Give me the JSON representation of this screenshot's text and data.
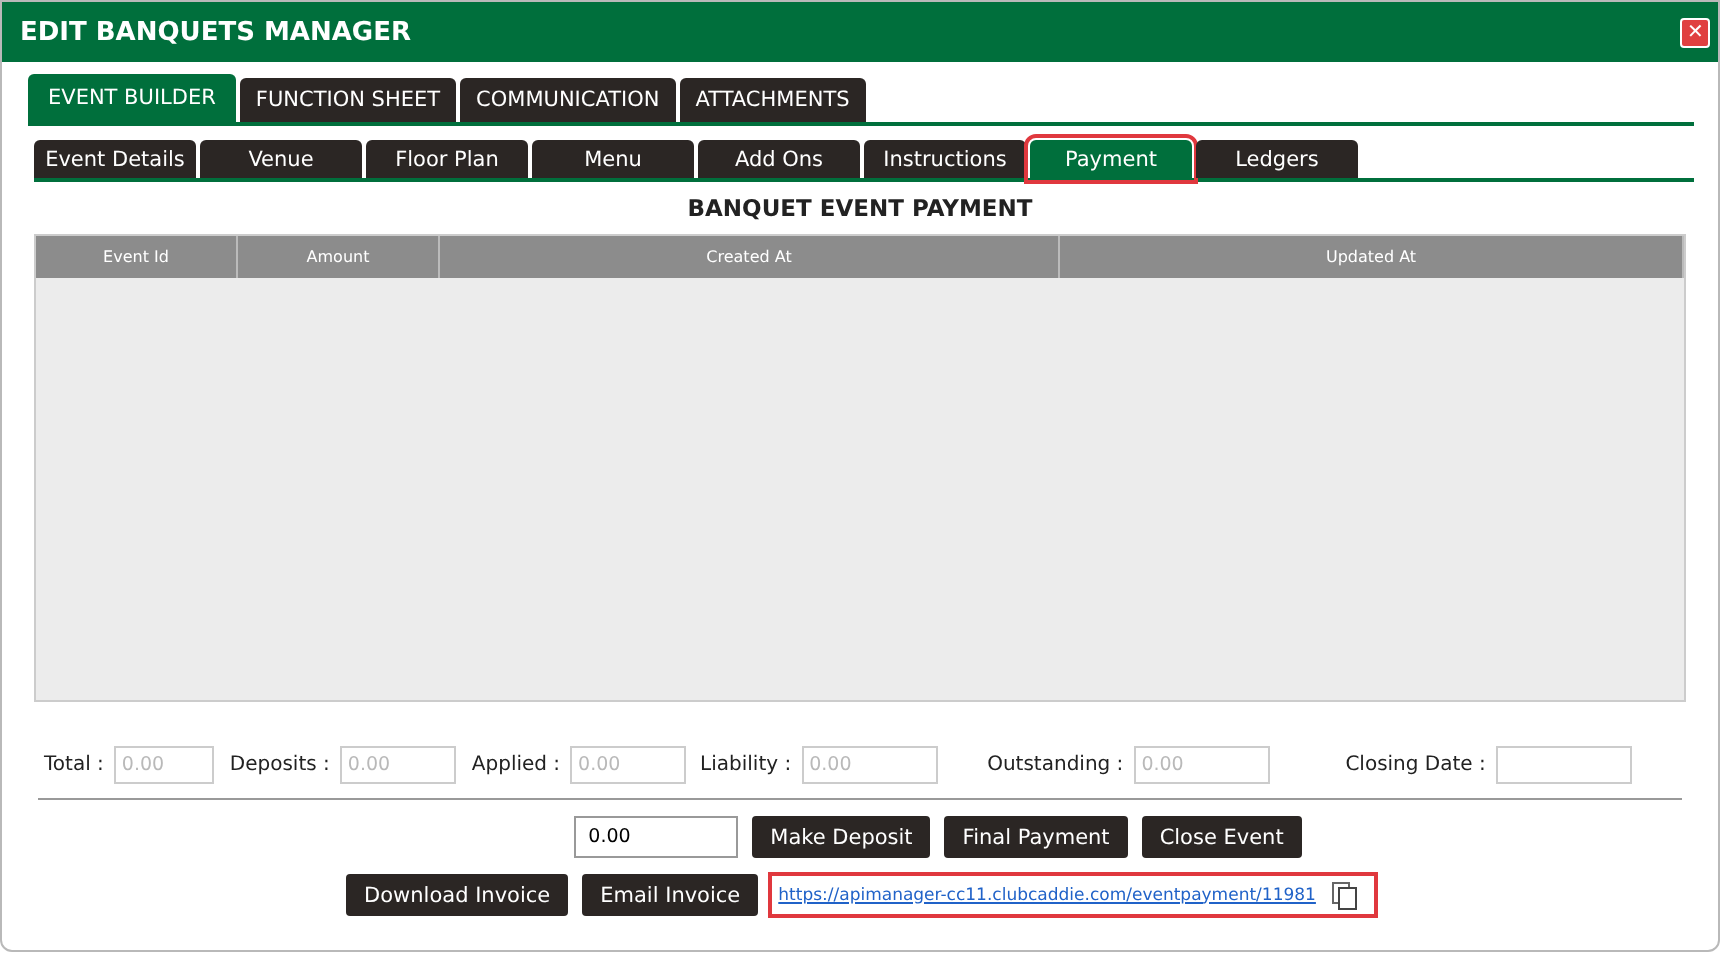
{
  "window": {
    "title": "EDIT BANQUETS MANAGER",
    "close": "✕"
  },
  "main_tabs": [
    {
      "label": "EVENT BUILDER",
      "selected": true
    },
    {
      "label": "FUNCTION SHEET",
      "selected": false
    },
    {
      "label": "COMMUNICATION",
      "selected": false
    },
    {
      "label": "ATTACHMENTS",
      "selected": false
    }
  ],
  "sub_tabs": [
    {
      "label": "Event Details",
      "selected": false,
      "highlighted": false
    },
    {
      "label": "Venue",
      "selected": false,
      "highlighted": false
    },
    {
      "label": "Floor Plan",
      "selected": false,
      "highlighted": false
    },
    {
      "label": "Menu",
      "selected": false,
      "highlighted": false
    },
    {
      "label": "Add Ons",
      "selected": false,
      "highlighted": false
    },
    {
      "label": "Instructions",
      "selected": false,
      "highlighted": false
    },
    {
      "label": "Payment",
      "selected": true,
      "highlighted": true
    },
    {
      "label": "Ledgers",
      "selected": false,
      "highlighted": false
    }
  ],
  "section_title": "BANQUET EVENT PAYMENT",
  "table": {
    "columns": [
      "Event Id",
      "Amount",
      "Created At",
      "Updated At"
    ]
  },
  "summary": [
    {
      "label": "Total :",
      "placeholder": "0.00"
    },
    {
      "label": "Deposits :",
      "placeholder": "0.00"
    },
    {
      "label": "Applied :",
      "placeholder": "0.00"
    },
    {
      "label": "Liability :",
      "placeholder": "0.00"
    },
    {
      "label": "Outstanding :",
      "placeholder": "0.00"
    },
    {
      "label": "Closing Date :"
    }
  ],
  "amount": {
    "value": "0.00"
  },
  "actions": [
    "Make Deposit",
    "Final Payment",
    "Close Event"
  ],
  "invoice_actions": [
    "Download Invoice",
    "Email Invoice"
  ],
  "payment_link": {
    "url": "https://apimanager-cc11.clubcaddie.com/eventpayment/11981",
    "highlighted": true
  }
}
